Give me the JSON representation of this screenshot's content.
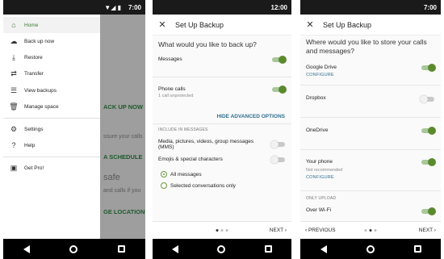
{
  "phone1": {
    "status": {
      "time": "7:00",
      "signal": "▼◢ ▮"
    },
    "drawer": {
      "items": [
        {
          "icon": "home-icon",
          "glyph": "⌂",
          "label": "Home"
        },
        {
          "icon": "cloud-upload-icon",
          "glyph": "☁",
          "label": "Back up now"
        },
        {
          "icon": "restore-icon",
          "glyph": "⤓",
          "label": "Restore"
        },
        {
          "icon": "transfer-icon",
          "glyph": "⇄",
          "label": "Transfer"
        },
        {
          "icon": "view-backups-icon",
          "glyph": "☰",
          "label": "View backups"
        },
        {
          "icon": "delete-icon",
          "glyph": "🗑",
          "label": "Manage space"
        },
        {
          "icon": "gear-icon",
          "glyph": "⚙",
          "label": "Settings"
        },
        {
          "icon": "help-icon",
          "glyph": "?",
          "label": "Help"
        },
        {
          "icon": "get-pro-icon",
          "glyph": "▣",
          "label": "Get Pro!"
        }
      ]
    },
    "behind": {
      "backup": "ACK UP NOW",
      "calls": "ssure your calls",
      "schedule": "A SCHEDULE",
      "safe": "safe",
      "calls2": "and calls if you",
      "location": "GE LOCATION"
    }
  },
  "phone2": {
    "status": {
      "time": "12:00"
    },
    "title": "Set Up Backup",
    "question": "What would you like to back up?",
    "messages": "Messages",
    "phone_calls": "Phone calls",
    "phone_calls_sub": "1 call unprotected",
    "hide_advanced": "HIDE ADVANCED OPTIONS",
    "include_section": "INCLUDE IN MESSAGES",
    "media": "Media, pictures, videos, group messages (MMS)",
    "emojis": "Emojis & special characters",
    "all_messages": "All messages",
    "selected_conv": "Selected conversations only",
    "next": "NEXT ›"
  },
  "phone3": {
    "status": {
      "time": "7:00"
    },
    "title": "Set Up Backup",
    "question": "Where would you like to store your calls and messages?",
    "google_drive": "Google Drive",
    "configure": "CONFIGURE",
    "dropbox": "Dropbox",
    "onedrive": "OneDrive",
    "your_phone": "Your phone",
    "not_recommended": "Not recommended",
    "only_upload": "ONLY UPLOAD",
    "over_wifi": "Over Wi-Fi",
    "previous": "‹ PREVIOUS",
    "next": "NEXT ›"
  },
  "colors": {
    "accent": "#5b8a2e",
    "link": "#2f6f8f"
  }
}
